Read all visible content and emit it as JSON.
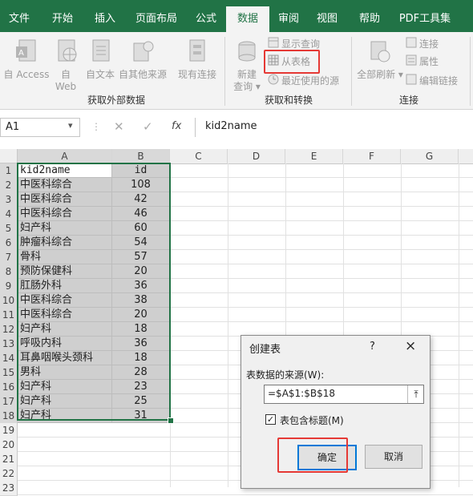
{
  "ribbon": {
    "tabs": [
      "文件",
      "开始",
      "插入",
      "页面布局",
      "公式",
      "数据",
      "审阅",
      "视图",
      "帮助",
      "PDF工具集"
    ],
    "active_tab": "数据",
    "groups": {
      "get_external": {
        "label": "获取外部数据",
        "items": [
          "自 Access",
          "自",
          "Web",
          "自文本",
          "自其他来源",
          "现有连接"
        ]
      },
      "get_transform": {
        "label": "获取和转换",
        "new_query": "新建",
        "new_query_2": "查询",
        "show_queries": "显示查询",
        "from_table": "从表格",
        "recent_sources": "最近使用的源"
      },
      "connections": {
        "label": "连接",
        "refresh_all": "全部刷新",
        "connections": "连接",
        "properties": "属性",
        "edit_links": "编辑链接"
      }
    }
  },
  "formula_bar": {
    "name_box": "A1",
    "fx": "fx",
    "content": "kid2name"
  },
  "sheet": {
    "columns": [
      "A",
      "B",
      "C",
      "D",
      "E",
      "F",
      "G"
    ],
    "rows": [
      [
        "kid2name",
        "id"
      ],
      [
        "中医科综合",
        "108"
      ],
      [
        "中医科综合",
        "42"
      ],
      [
        "中医科综合",
        "46"
      ],
      [
        "妇产科",
        "60"
      ],
      [
        "肿瘤科综合",
        "54"
      ],
      [
        "骨科",
        "57"
      ],
      [
        "预防保健科",
        "20"
      ],
      [
        "肛肠外科",
        "36"
      ],
      [
        "中医科综合",
        "38"
      ],
      [
        "中医科综合",
        "20"
      ],
      [
        "妇产科",
        "18"
      ],
      [
        "呼吸内科",
        "36"
      ],
      [
        "耳鼻咽喉头颈科",
        "18"
      ],
      [
        "男科",
        "28"
      ],
      [
        "妇产科",
        "23"
      ],
      [
        "妇产科",
        "25"
      ],
      [
        "妇产科",
        "31"
      ]
    ],
    "row_numbers": [
      "1",
      "2",
      "3",
      "4",
      "5",
      "6",
      "7",
      "8",
      "9",
      "10",
      "11",
      "12",
      "13",
      "14",
      "15",
      "16",
      "17",
      "18",
      "19",
      "20",
      "21",
      "22",
      "23"
    ]
  },
  "dialog": {
    "title": "创建表",
    "help": "?",
    "close": "×",
    "source_label": "表数据的来源(W):",
    "source_value": "=$A$1:$B$18",
    "header_checkbox_label": "表包含标题(M)",
    "header_checked": true,
    "ok": "确定",
    "cancel": "取消"
  },
  "colors": {
    "excel_green": "#217346",
    "highlight_red": "#e53935",
    "selection_gray": "#cfcfcf"
  }
}
